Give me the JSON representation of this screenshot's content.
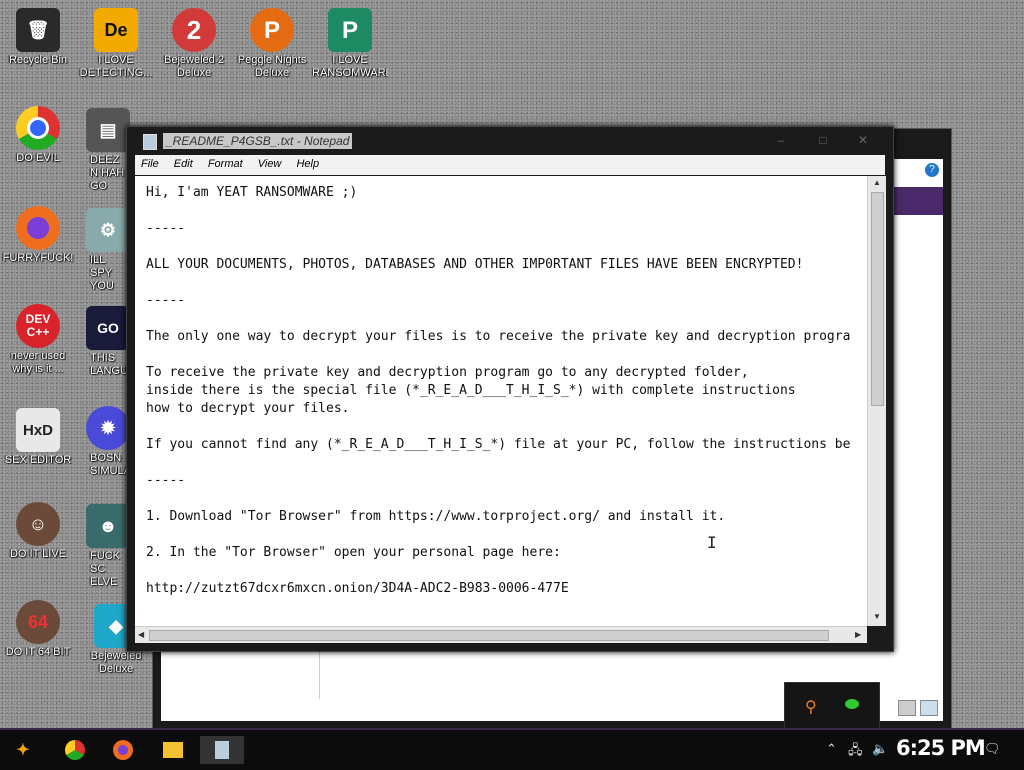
{
  "desktop_icons": [
    {
      "label": "Recycle Bin",
      "icon": "recycle-bin-icon",
      "color": "#2a2a2a",
      "glyph": "🗑"
    },
    {
      "label": "I LOVE DETECTING...",
      "icon": "detect-it-easy-icon",
      "color": "#f2a900",
      "glyph": "De"
    },
    {
      "label": "Bejeweled 2 Deluxe",
      "icon": "bejeweled2-icon",
      "color": "#d23a3a",
      "glyph": "2"
    },
    {
      "label": "Peggle Nights Deluxe",
      "icon": "peggle-icon",
      "color": "#e46b12",
      "glyph": "P"
    },
    {
      "label": "I LOVE RANSOMWARE",
      "icon": "publisher-icon",
      "color": "#1d8a64",
      "glyph": "P"
    },
    {
      "label": "DO EVIL",
      "icon": "chrome-icon",
      "color": "#e0e0e0",
      "glyph": "●"
    },
    {
      "label": "DEEZ N HAH GO",
      "icon": "files-icon",
      "color": "#555",
      "glyph": "▤"
    },
    {
      "label": "FURRYFUCK!",
      "icon": "firefox-icon",
      "color": "#ef6d1f",
      "glyph": "◉"
    },
    {
      "label": "ILL SPY YOU",
      "icon": "tool-icon",
      "color": "#8aa",
      "glyph": "⚙"
    },
    {
      "label": "never used why is it ...",
      "icon": "devcpp-icon",
      "color": "#d8232a",
      "glyph": "DEV"
    },
    {
      "label": "THIS LANGUAG",
      "icon": "goland-icon",
      "color": "#1a1a3a",
      "glyph": "GO"
    },
    {
      "label": "SEX EDITOR",
      "icon": "hxd-icon",
      "color": "#e8e8e8",
      "glyph": "HxD"
    },
    {
      "label": "BOSN SIMULA",
      "icon": "virus-icon",
      "color": "#4a4ad8",
      "glyph": "✹"
    },
    {
      "label": "DO IT LIVE",
      "icon": "portrait-icon",
      "color": "#6b4a3a",
      "glyph": "☺"
    },
    {
      "label": "FUCK SC ELVE",
      "icon": "face-icon",
      "color": "#3a6b6b",
      "glyph": "☻"
    },
    {
      "label": "DO IT 64 BIT",
      "icon": "portrait64-icon",
      "color": "#6b4a3a",
      "glyph": "64"
    },
    {
      "label": "Bejeweled Deluxe",
      "icon": "bejeweled-icon",
      "color": "#1ea7c8",
      "glyph": "◆"
    }
  ],
  "notepad": {
    "title": "_README_P4GSB_.txt - Notepad",
    "menu": [
      "File",
      "Edit",
      "Format",
      "View",
      "Help"
    ],
    "lines": [
      "Hi, I'am YEAT RANSOMWARE ;)",
      "",
      "-----",
      "",
      "ALL YOUR DOCUMENTS, PHOTOS, DATABASES AND OTHER IMP0RTANT FILES HAVE BEEN ENCRYPTED!",
      "",
      "-----",
      "",
      "The only one way to decrypt your files is to receive the private key and decryption progra",
      "",
      "To receive the private key and decryption program go to any decrypted folder,",
      "inside there is the special file (*_R_E_A_D___T_H_I_S_*) with complete instructions",
      "how to decrypt your files.",
      "",
      "If you cannot find any (*_R_E_A_D___T_H_I_S_*) file at your PC, follow the instructions be",
      "",
      "-----",
      "",
      "1. Download \"Tor Browser\" from https://www.torproject.org/ and install it.",
      "",
      "2. In the \"Tor Browser\" open your personal page here:",
      "",
      "http://zutzt67dcxr6mxcn.onion/3D4A-ADC2-B983-0006-477E"
    ]
  },
  "taskbar": {
    "clock": "6:25 PM"
  }
}
